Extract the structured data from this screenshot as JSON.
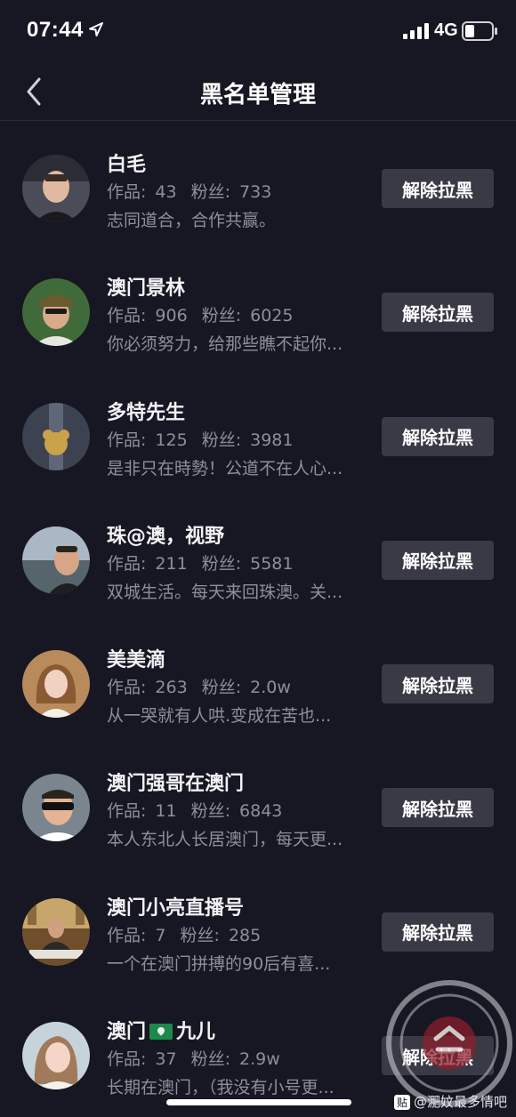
{
  "status_bar": {
    "time": "07:44",
    "network": "4G",
    "icons": [
      "location-arrow-icon",
      "signal-bars-icon",
      "battery-icon"
    ]
  },
  "nav": {
    "title": "黑名单管理",
    "back_icon": "chevron-left-icon"
  },
  "list": {
    "stats_works_label": "作品:",
    "stats_fans_label": "粉丝:",
    "unblock_label": "解除拉黑",
    "items": [
      {
        "name": "白毛",
        "works": "43",
        "fans": "733",
        "bio": "志同道合，合作共赢。"
      },
      {
        "name": "澳门景林",
        "works": "906",
        "fans": "6025",
        "bio": "你必须努力，给那些瞧不起你..."
      },
      {
        "name": "多特先生",
        "works": "125",
        "fans": "3981",
        "bio": "是非只在時勢！公道不在人心..."
      },
      {
        "name": "珠@澳，视野",
        "works": "211",
        "fans": "5581",
        "bio": "双城生活。每天来回珠澳。关..."
      },
      {
        "name": "美美滴",
        "works": "263",
        "fans": "2.0w",
        "bio": "从一哭就有人哄.变成在苦也..."
      },
      {
        "name": "澳门强哥在澳门",
        "works": "11",
        "fans": "6843",
        "bio": "本人东北人长居澳门，每天更..."
      },
      {
        "name": "澳门小亮直播号",
        "works": "7",
        "fans": "285",
        "bio": "一个在澳门拼搏的90后有喜..."
      },
      {
        "name_prefix": "澳门",
        "name_suffix": "九儿",
        "name_icon": "macau-flag-icon",
        "works": "37",
        "fans": "2.9w",
        "bio": "长期在澳门，（我没有小号更..."
      }
    ]
  },
  "watermark": {
    "badge": "贴",
    "caption": "@淝妏最多情吧"
  },
  "colors": {
    "background": "#161722",
    "button_bg": "#393a45",
    "secondary_text": "#8e8f99"
  }
}
